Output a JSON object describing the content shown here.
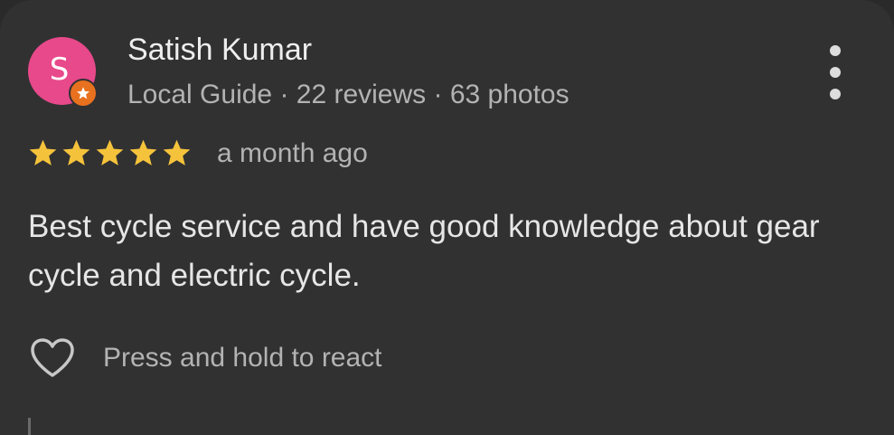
{
  "review": {
    "author": {
      "avatar_letter": "S",
      "avatar_color": "#e8498a",
      "badge_color": "#e8711f",
      "badge_icon": "star-badge-icon",
      "name": "Satish Kumar",
      "meta": "Local Guide · 22 reviews · 63 photos"
    },
    "rating": 5,
    "rating_max": 5,
    "star_color": "#f5c33b",
    "time_ago": "a month ago",
    "text": "Best cycle service and have good knowledge about gear cycle and electric cycle.",
    "react_label": "Press and hold to react",
    "react_icon": "heart-icon",
    "menu_icon": "more-vert-icon"
  }
}
